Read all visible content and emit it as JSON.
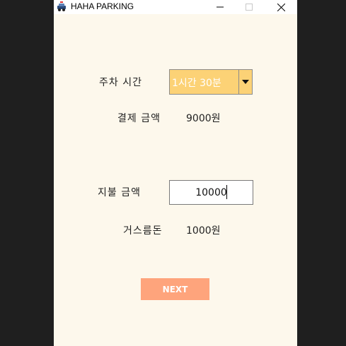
{
  "window": {
    "title": "HAHA PARKING"
  },
  "parking_time": {
    "label": "주차 시간",
    "selected": "1시간 30분"
  },
  "payment_amount": {
    "label": "결제 금액",
    "value": "9000원"
  },
  "paid_amount": {
    "label": "지불 금액",
    "input_value": "10000"
  },
  "change": {
    "label": "거스름돈",
    "value": "1000원"
  },
  "next_button": {
    "label": "NEXT"
  },
  "colors": {
    "background": "#fdf8ec",
    "select": "#fcd276",
    "button": "#fea47c"
  }
}
